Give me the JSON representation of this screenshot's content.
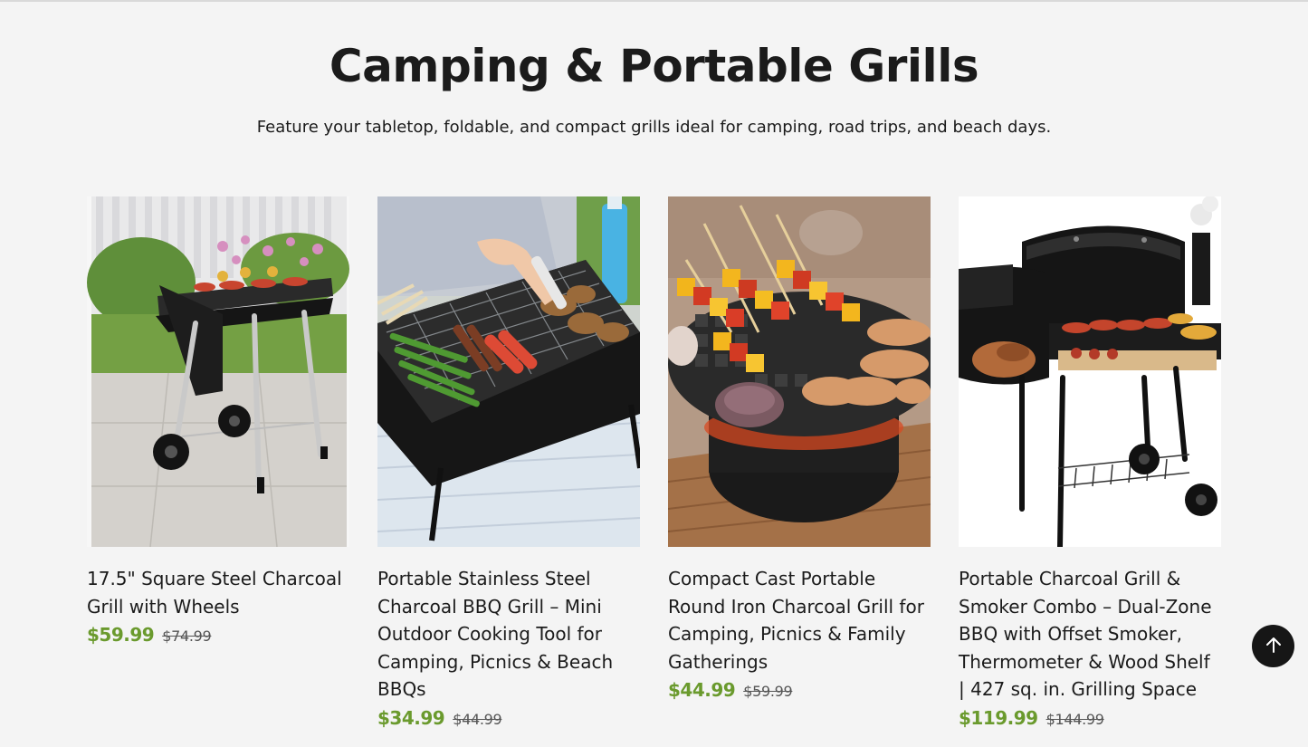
{
  "section": {
    "title": "Camping & Portable Grills",
    "subtitle": "Feature your tabletop, foldable, and compact grills ideal for camping, road trips, and beach days."
  },
  "products": [
    {
      "title": "17.5\" Square Steel Charcoal Grill with Wheels",
      "price": "$59.99",
      "compare_price": "$74.99"
    },
    {
      "title": "Portable Stainless Steel Charcoal BBQ Grill – Mini Outdoor Cooking Tool for Camping, Picnics & Beach BBQs",
      "price": "$34.99",
      "compare_price": "$44.99"
    },
    {
      "title": "Compact Cast Portable Round Iron Charcoal Grill for Camping, Picnics & Family Gatherings",
      "price": "$44.99",
      "compare_price": "$59.99"
    },
    {
      "title": "Portable Charcoal Grill & Smoker Combo – Dual-Zone BBQ with Offset Smoker, Thermometer & Wood Shelf | 427 sq. in. Grilling Space",
      "price": "$119.99",
      "compare_price": "$144.99"
    }
  ],
  "colors": {
    "background": "#f4f4f4",
    "sale_price": "#6a9a2d",
    "text": "#1b1b1b",
    "back_to_top_bg": "#161616"
  },
  "icons": {
    "back_to_top": "arrow-up-icon"
  }
}
